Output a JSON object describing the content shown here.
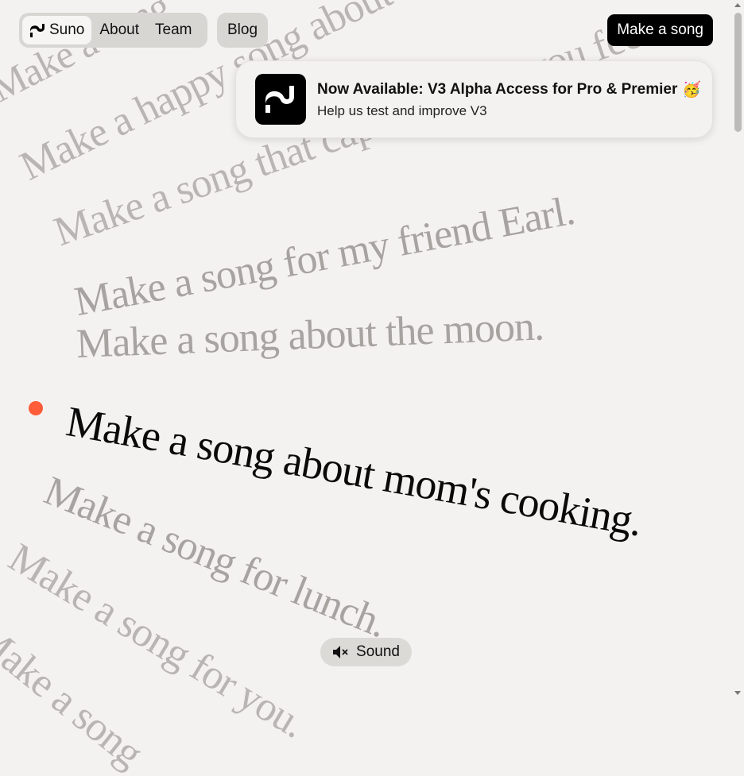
{
  "nav": {
    "brand_label": "Suno",
    "about_label": "About",
    "team_label": "Team",
    "blog_label": "Blog",
    "cta_label": "Make a song"
  },
  "announcement": {
    "title": "Now Available: V3 Alpha Access for Pro & Premier",
    "emoji": "🥳",
    "subtitle": "Help us test and improve V3"
  },
  "phrases": [
    "Make a happy song about how you feel.",
    "Make a song that captures how you feel.",
    "Make a song for my friend Earl.",
    "Make a song about the moon.",
    "Make a song about mom's cooking.",
    "Make a song for lunch.",
    "Make a song for you.",
    "Make a song"
  ],
  "phrase_top_partial": "Make a song",
  "sound": {
    "label": "Sound",
    "icon": "speaker-muted-icon"
  },
  "colors": {
    "background": "#f4f2f0",
    "accent_dot": "#ff5c39",
    "cta_bg": "#000000",
    "active_phrase": "#0a0a0a",
    "faded_phrase": "#b8b5b2"
  }
}
